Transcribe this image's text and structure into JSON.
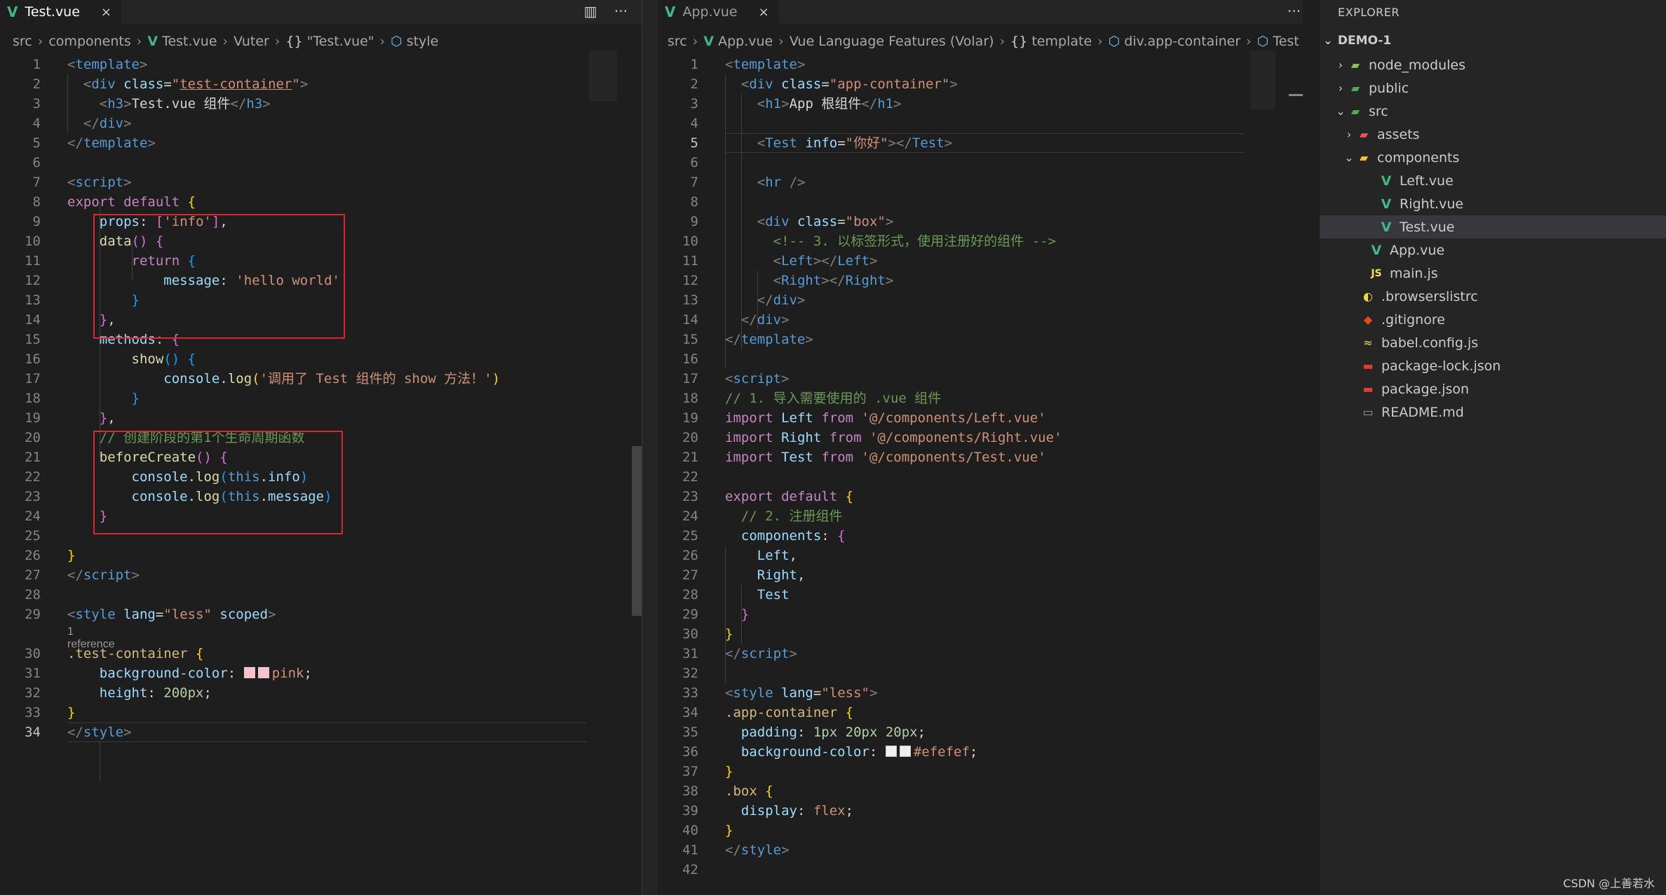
{
  "left_editor": {
    "tab": {
      "icon": "vue-icon",
      "title": "Test.vue",
      "close": "×"
    },
    "actions": [
      "split-editor-icon",
      "more-icon"
    ],
    "actions_glyphs": [
      "▥",
      "···"
    ],
    "breadcrumb": {
      "items": [
        "src",
        "components",
        "Test.vue",
        "Vuter",
        "\"Test.vue\"",
        "style"
      ],
      "sep": "›",
      "braces": "{}"
    },
    "reference_lens": "1 reference",
    "swatch_color": "#ffc0cb",
    "current_line": "34"
  },
  "right_editor": {
    "tab": {
      "icon": "vue-icon",
      "title": "App.vue",
      "close": "×"
    },
    "actions": [
      "more-icon"
    ],
    "actions_glyphs": [
      "···"
    ],
    "breadcrumb": {
      "items": [
        "src",
        "App.vue",
        "Vue Language Features (Volar)",
        "template",
        "div.app-container",
        "Test"
      ],
      "sep": "›",
      "braces": "{}"
    },
    "swatch_color": "#efefef",
    "current_line": "5"
  },
  "explorer": {
    "header": "EXPLORER",
    "root": "DEMO-1",
    "root_chevron": "⌄",
    "items": [
      {
        "label": "node_modules",
        "chev": "›",
        "icon": "folder-node-icon",
        "glyph": "▰",
        "color": "#8bc34a"
      },
      {
        "label": "public",
        "chev": "›",
        "icon": "folder-public-icon",
        "glyph": "▰",
        "color": "#4caf50"
      },
      {
        "label": "src",
        "chev": "⌄",
        "icon": "folder-src-icon",
        "glyph": "▰",
        "color": "#4caf50"
      },
      {
        "label": "assets",
        "chev": "›",
        "icon": "folder-assets-icon",
        "glyph": "▰",
        "color": "#ef5350"
      },
      {
        "label": "components",
        "chev": "⌄",
        "icon": "folder-components-icon",
        "glyph": "▰",
        "color": "#fbc02d"
      },
      {
        "label": "Left.vue",
        "chev": "",
        "icon": "vue-icon",
        "glyph": "V",
        "color": "#41b883"
      },
      {
        "label": "Right.vue",
        "chev": "",
        "icon": "vue-icon",
        "glyph": "V",
        "color": "#41b883"
      },
      {
        "label": "Test.vue",
        "chev": "",
        "icon": "vue-icon",
        "glyph": "V",
        "color": "#41b883"
      },
      {
        "label": "App.vue",
        "chev": "",
        "icon": "vue-icon",
        "glyph": "V",
        "color": "#41b883"
      },
      {
        "label": "main.js",
        "chev": "",
        "icon": "js-icon",
        "glyph": "JS",
        "color": "#f1e05a"
      },
      {
        "label": ".browserslistrc",
        "chev": "",
        "icon": "browserslist-icon",
        "glyph": "◐",
        "color": "#fdd835"
      },
      {
        "label": ".gitignore",
        "chev": "",
        "icon": "git-icon",
        "glyph": "◆",
        "color": "#e64a19"
      },
      {
        "label": "babel.config.js",
        "chev": "",
        "icon": "babel-icon",
        "glyph": "≈",
        "color": "#f5da55"
      },
      {
        "label": "package-lock.json",
        "chev": "",
        "icon": "npm-icon",
        "glyph": "▬",
        "color": "#e53935"
      },
      {
        "label": "package.json",
        "chev": "",
        "icon": "npm-icon",
        "glyph": "▬",
        "color": "#e53935"
      },
      {
        "label": "README.md",
        "chev": "",
        "icon": "markdown-icon",
        "glyph": "▭",
        "color": "#90a4ae"
      }
    ],
    "selected_index": 7
  },
  "footer_credit": "CSDN @上善若水"
}
